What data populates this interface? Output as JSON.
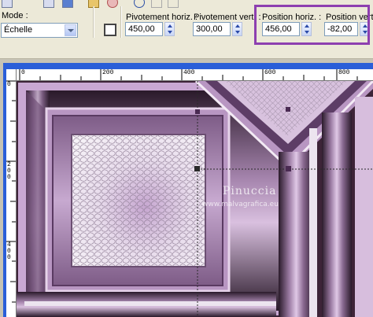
{
  "toolbar": {
    "mode_label": "Mode :",
    "mode_value": "Échelle",
    "pivot_h_label": "Pivotement horiz. :",
    "pivot_h_value": "450,00",
    "pivot_v_label": "Pivotement vert. :",
    "pivot_v_value": "300,00",
    "pos_h_label": "Position horiz. :",
    "pos_h_value": "456,00",
    "pos_v_label": "Position vert",
    "pos_v_value": "-82,00"
  },
  "ruler": {
    "h_ticks": [
      "0",
      "200",
      "400",
      "600",
      "800"
    ],
    "v_ticks": [
      "0",
      "200",
      "400"
    ]
  },
  "watermark": {
    "name": "Pinuccia",
    "url": "www.malvagrafica.eu"
  },
  "colors": {
    "highlight": "#8d3fb0",
    "frame_blue": "#2a5ed8",
    "lilac": "#c8a8d2",
    "dark_purple": "#3d2438"
  },
  "icons": [
    "save-icon",
    "layers-icon",
    "deform-tool-icon",
    "redo-icon",
    "reset-icon",
    "apply-icon",
    "cancel-icon",
    "deform-frame-icon"
  ]
}
